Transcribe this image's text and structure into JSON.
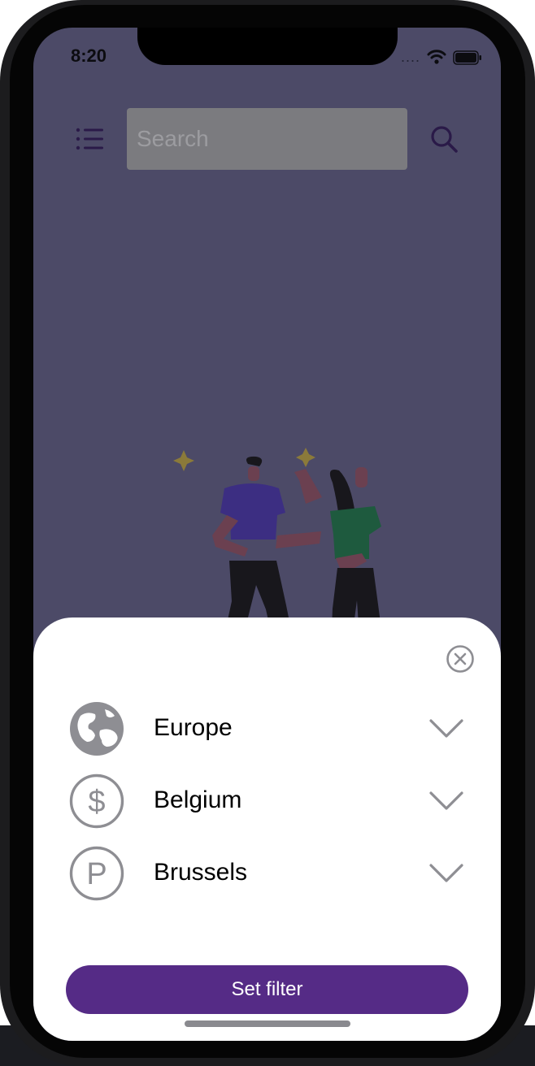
{
  "status_bar": {
    "time": "8:20",
    "signal": "...."
  },
  "header": {
    "search_placeholder": "Search",
    "menu_icon": "list-icon",
    "search_icon": "magnifier-icon"
  },
  "illustration": {
    "description_icon": "people-celebrating-illustration"
  },
  "filter_sheet": {
    "close_icon": "close-circle-icon",
    "rows": [
      {
        "label": "Europe",
        "icon": "globe-icon"
      },
      {
        "label": "Belgium",
        "icon": "currency-dollar-icon"
      },
      {
        "label": "Brussels",
        "icon": "parking-icon"
      }
    ],
    "set_filter_label": "Set filter"
  },
  "colors": {
    "overlay": "#4c4a67",
    "accent": "#552b86",
    "icon_gray": "#8e8e93"
  }
}
